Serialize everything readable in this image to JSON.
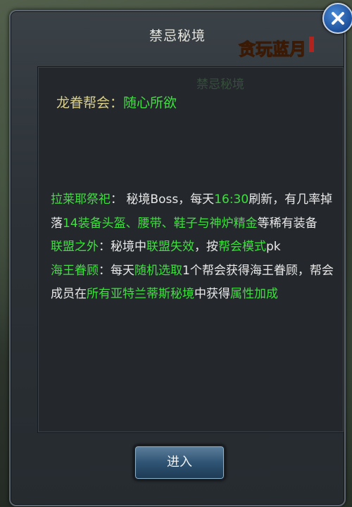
{
  "panel": {
    "title": "禁忌秘境",
    "logo_text": "贪玩蓝月"
  },
  "header": {
    "faint_text": "禁忌秘境",
    "guild_label": "龙眷帮会：",
    "guild_value": "随心所欲"
  },
  "sections": {
    "s1_head": "拉莱耶祭祀",
    "s1_p1": "： 秘境Boss，每天",
    "s1_time": "16:30",
    "s1_p2": "刷新，有几率掉落",
    "s1_items": "14装备头盔、腰带、鞋子与神炉精金",
    "s1_p3": "等稀有装备",
    "s2_head": "联盟之外",
    "s2_p1": "：秘境中",
    "s2_hl1": "联盟失效",
    "s2_p2": "，按",
    "s2_hl2": "帮会模式",
    "s2_p3": "pk",
    "s3_head": "海王眷顾",
    "s3_p1": "：每天",
    "s3_hl1": "随机选取",
    "s3_p2": "1个帮会获得海王眷顾，帮会成员在",
    "s3_hl2": "所有亚特兰蒂斯秘境",
    "s3_p3": "中获得",
    "s3_hl3": "属性加成"
  },
  "buttons": {
    "enter_label": "进入",
    "close_icon": "close-icon"
  },
  "colors": {
    "highlight_green": "#3ee03e",
    "guild_label_gold": "#d9cf8a",
    "panel_bg": "#2b3136",
    "button_blue": "#2f5474"
  }
}
